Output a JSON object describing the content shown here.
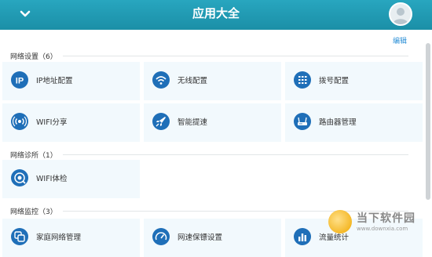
{
  "header": {
    "title": "应用大全"
  },
  "edit_label": "编辑",
  "sections": [
    {
      "title": "网络设置（6）",
      "items": [
        {
          "label": "IP地址配置",
          "icon": "ip-icon"
        },
        {
          "label": "无线配置",
          "icon": "wifi-icon"
        },
        {
          "label": "拨号配置",
          "icon": "dial-icon"
        },
        {
          "label": "WIFI分享",
          "icon": "share-icon"
        },
        {
          "label": "智能提速",
          "icon": "rocket-icon"
        },
        {
          "label": "路由器管理",
          "icon": "router-icon"
        }
      ]
    },
    {
      "title": "网络诊所（1）",
      "items": [
        {
          "label": "WIFI体检",
          "icon": "checkup-icon"
        }
      ]
    },
    {
      "title": "网络监控（3）",
      "items": [
        {
          "label": "家庭网络管理",
          "icon": "home-network-icon"
        },
        {
          "label": "网速保镖设置",
          "icon": "speed-gauge-icon"
        },
        {
          "label": "流量统计",
          "icon": "traffic-stats-icon"
        }
      ]
    }
  ],
  "watermark": {
    "text": "当下软件园",
    "url": "www.downxia.com"
  },
  "colors": {
    "header": "#1f9ab3",
    "icon": "#1f6fb8",
    "tile_bg": "#f2f9fd",
    "edit": "#2a8fd6"
  }
}
